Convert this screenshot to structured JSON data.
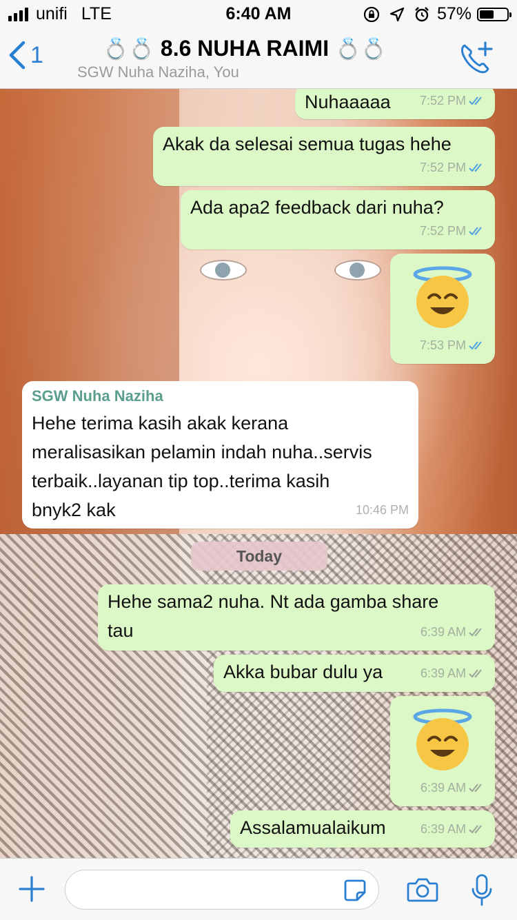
{
  "status": {
    "carrier": "unifi",
    "network": "LTE",
    "time": "6:40 AM",
    "battery": "57%",
    "battery_level": 0.57
  },
  "header": {
    "back_count": "1",
    "title": "8.6 NUHA RAIMI",
    "title_ring": "💍💍",
    "subtitle": "SGW Nuha Naziha, You"
  },
  "messages": [
    {
      "text": "Nuhaaaaa",
      "time": "7:52 PM",
      "ticks": "read"
    },
    {
      "text": "Akak da selesai semua tugas hehe",
      "time": "7:52 PM",
      "ticks": "read"
    },
    {
      "text": "Ada apa2 feedback dari nuha?",
      "time": "7:52 PM",
      "ticks": "read"
    },
    {
      "emoji": "smiling-face-with-halo",
      "time": "7:53 PM",
      "ticks": "read"
    },
    {
      "sender": "SGW Nuha Naziha",
      "lines": [
        "Hehe terima kasih akak kerana",
        "meralisasikan pelamin indah nuha..servis",
        "terbaik..layanan tip top..terima kasih",
        "bnyk2 kak"
      ],
      "time": "10:46 PM"
    },
    {
      "lines": [
        "Hehe sama2 nuha. Nt ada gamba share",
        "tau"
      ],
      "time": "6:39 AM",
      "ticks": "delivered"
    },
    {
      "text": "Akka bubar dulu ya",
      "time": "6:39 AM",
      "ticks": "delivered"
    },
    {
      "emoji": "smiling-face-with-halo",
      "time": "6:39 AM",
      "ticks": "delivered"
    },
    {
      "text": "Assalamualaikum",
      "time": "6:39 AM",
      "ticks": "delivered"
    }
  ],
  "date_divider": "Today",
  "colors": {
    "accent": "#2b7fd0",
    "outgoing_bubble": "#dcf8c6",
    "incoming_bubble": "#ffffff",
    "sender_name": "#5a9e8e",
    "read_ticks": "#4fa3e0",
    "delivered_ticks": "#9aa49a"
  },
  "input": {
    "value": "",
    "placeholder": ""
  }
}
